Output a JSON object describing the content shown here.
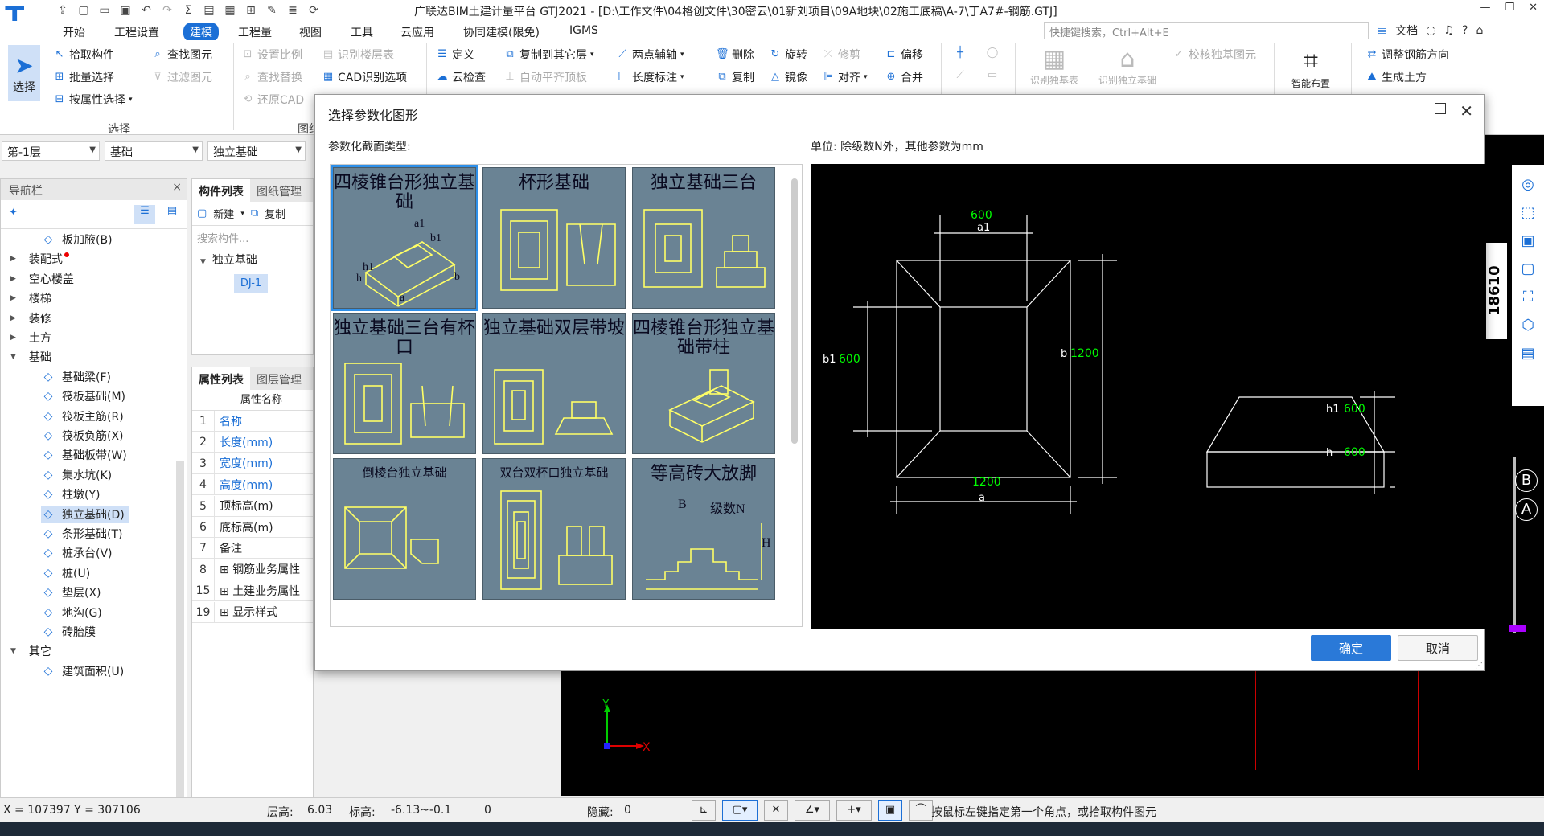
{
  "app": {
    "title": "广联达BIM土建计量平台 GTJ2021 - [D:\\工作文件\\04格创文件\\30密云\\01新刘项目\\09A地块\\02施工底稿\\A-7\\丁A7#-钢筋.GTJ]",
    "menus": [
      "开始",
      "工程设置",
      "建模",
      "工程量",
      "视图",
      "工具",
      "云应用",
      "协同建模(限免)",
      "IGMS"
    ],
    "active_menu": "建模",
    "search_placeholder": "快捷键搜索，Ctrl+Alt+E",
    "doc_label": "文档"
  },
  "ribbon": {
    "select": "选择",
    "pick": "拾取构件",
    "batch": "批量选择",
    "byprop": "按属性选择",
    "find": "查找图元",
    "filter": "过滤图元",
    "group_select": "选择",
    "scale": "设置比例",
    "recognize_floor": "识别楼层表",
    "find_replace": "查找替换",
    "cad_options": "CAD识别选项",
    "restore_cad": "还原CAD",
    "group_drawing": "图纸",
    "define": "定义",
    "copy_to_floor": "复制到其它层",
    "two_point_axis": "两点辅轴",
    "cloud_check": "云检查",
    "auto_level": "自动平齐顶板",
    "length_mark": "长度标注",
    "delete": "删除",
    "rotate": "旋转",
    "trim": "修剪",
    "offset": "偏移",
    "copy": "复制",
    "mirror": "镜像",
    "align": "对齐",
    "merge": "合并",
    "recognize_table": "识别独基表",
    "recognize_found": "识别独立基础",
    "verify": "校核独基图元",
    "smart_layout": "智能布置",
    "adjust_rebar": "调整钢筋方向",
    "gen_earthwork": "生成土方"
  },
  "selectors": {
    "floor": "第-1层",
    "category": "基础",
    "type": "独立基础"
  },
  "nav": {
    "title": "导航栏",
    "items": [
      {
        "label": "板加腋(B)",
        "level": 2
      },
      {
        "label": "装配式",
        "level": 1
      },
      {
        "label": "空心楼盖",
        "level": 1
      },
      {
        "label": "楼梯",
        "level": 1
      },
      {
        "label": "装修",
        "level": 1
      },
      {
        "label": "土方",
        "level": 1
      },
      {
        "label": "基础",
        "level": 1
      },
      {
        "label": "基础梁(F)",
        "level": 2
      },
      {
        "label": "筏板基础(M)",
        "level": 2
      },
      {
        "label": "筏板主筋(R)",
        "level": 2
      },
      {
        "label": "筏板负筋(X)",
        "level": 2
      },
      {
        "label": "基础板带(W)",
        "level": 2
      },
      {
        "label": "集水坑(K)",
        "level": 2
      },
      {
        "label": "柱墩(Y)",
        "level": 2
      },
      {
        "label": "独立基础(D)",
        "level": 2
      },
      {
        "label": "条形基础(T)",
        "level": 2
      },
      {
        "label": "桩承台(V)",
        "level": 2
      },
      {
        "label": "桩(U)",
        "level": 2
      },
      {
        "label": "垫层(X)",
        "level": 2
      },
      {
        "label": "地沟(G)",
        "level": 2
      },
      {
        "label": "砖胎膜",
        "level": 2
      },
      {
        "label": "其它",
        "level": 1
      },
      {
        "label": "建筑面积(U)",
        "level": 2
      }
    ],
    "selected": "独立基础(D)"
  },
  "components": {
    "tab1": "构件列表",
    "tab2": "图纸管理",
    "new": "新建",
    "copy": "复制",
    "search_placeholder": "搜索构件...",
    "group": "独立基础",
    "item": "DJ-1"
  },
  "properties": {
    "tab1": "属性列表",
    "tab2": "图层管理",
    "header": "属性名称",
    "rows": [
      {
        "n": "1",
        "name": "名称",
        "blue": true
      },
      {
        "n": "2",
        "name": "长度(mm)",
        "blue": true
      },
      {
        "n": "3",
        "name": "宽度(mm)",
        "blue": true
      },
      {
        "n": "4",
        "name": "高度(mm)",
        "blue": true
      },
      {
        "n": "5",
        "name": "顶标高(m)",
        "blue": false
      },
      {
        "n": "6",
        "name": "底标高(m)",
        "blue": false
      },
      {
        "n": "7",
        "name": "备注",
        "blue": false
      },
      {
        "n": "8",
        "name": "钢筋业务属性",
        "blue": false
      },
      {
        "n": "15",
        "name": "土建业务属性",
        "blue": false
      },
      {
        "n": "19",
        "name": "显示样式",
        "blue": false
      }
    ]
  },
  "dialog": {
    "title": "选择参数化图形",
    "section_label": "参数化截面类型:",
    "unit_label": "单位:    除级数N外，其他参数为mm",
    "ok": "确定",
    "cancel": "取消",
    "shapes": [
      "四棱锥台形独立基础",
      "杯形基础",
      "独立基础三台",
      "独立基础三台有杯口",
      "独立基础双层带坡",
      "四棱锥台形独立基础带柱",
      "倒棱台独立基础",
      "双台双杯口独立基础",
      "等高砖大放脚"
    ],
    "selected_shape": "四棱锥台形独立基础",
    "thumb_labels": {
      "s1": [
        "a1",
        "b1",
        "h1",
        "h",
        "a",
        "b"
      ],
      "sN": "级数N",
      "sH": "H",
      "sB": "B"
    },
    "preview": {
      "a1_value": "600",
      "a1_label": "a1",
      "a_value": "1200",
      "a_label": "a",
      "b1_label": "b1",
      "b1_value": "600",
      "b_label": "b",
      "b_value": "1200",
      "h1_label": "h1",
      "h1_value": "600",
      "h_label": "h",
      "h_value": "600"
    }
  },
  "canvas": {
    "grid_label": "18610",
    "axis_b": "B",
    "axis_a": "A",
    "axis_y": "Y",
    "axis_x": "X"
  },
  "status": {
    "coords": "X = 107397 Y = 307106",
    "floor_height_label": "层高:",
    "floor_height": "6.03",
    "elev_label": "标高:",
    "elev": "-6.13~-0.1",
    "zero": "0",
    "hidden_label": "隐藏:",
    "hidden": "0",
    "hint": "按鼠标左键指定第一个角点，或拾取构件图元"
  },
  "colors": {
    "accent": "#1b6fd6",
    "thumb_bg": "#6a8394",
    "thumb_line": "#ffff66",
    "dim_green": "#00ff00"
  }
}
